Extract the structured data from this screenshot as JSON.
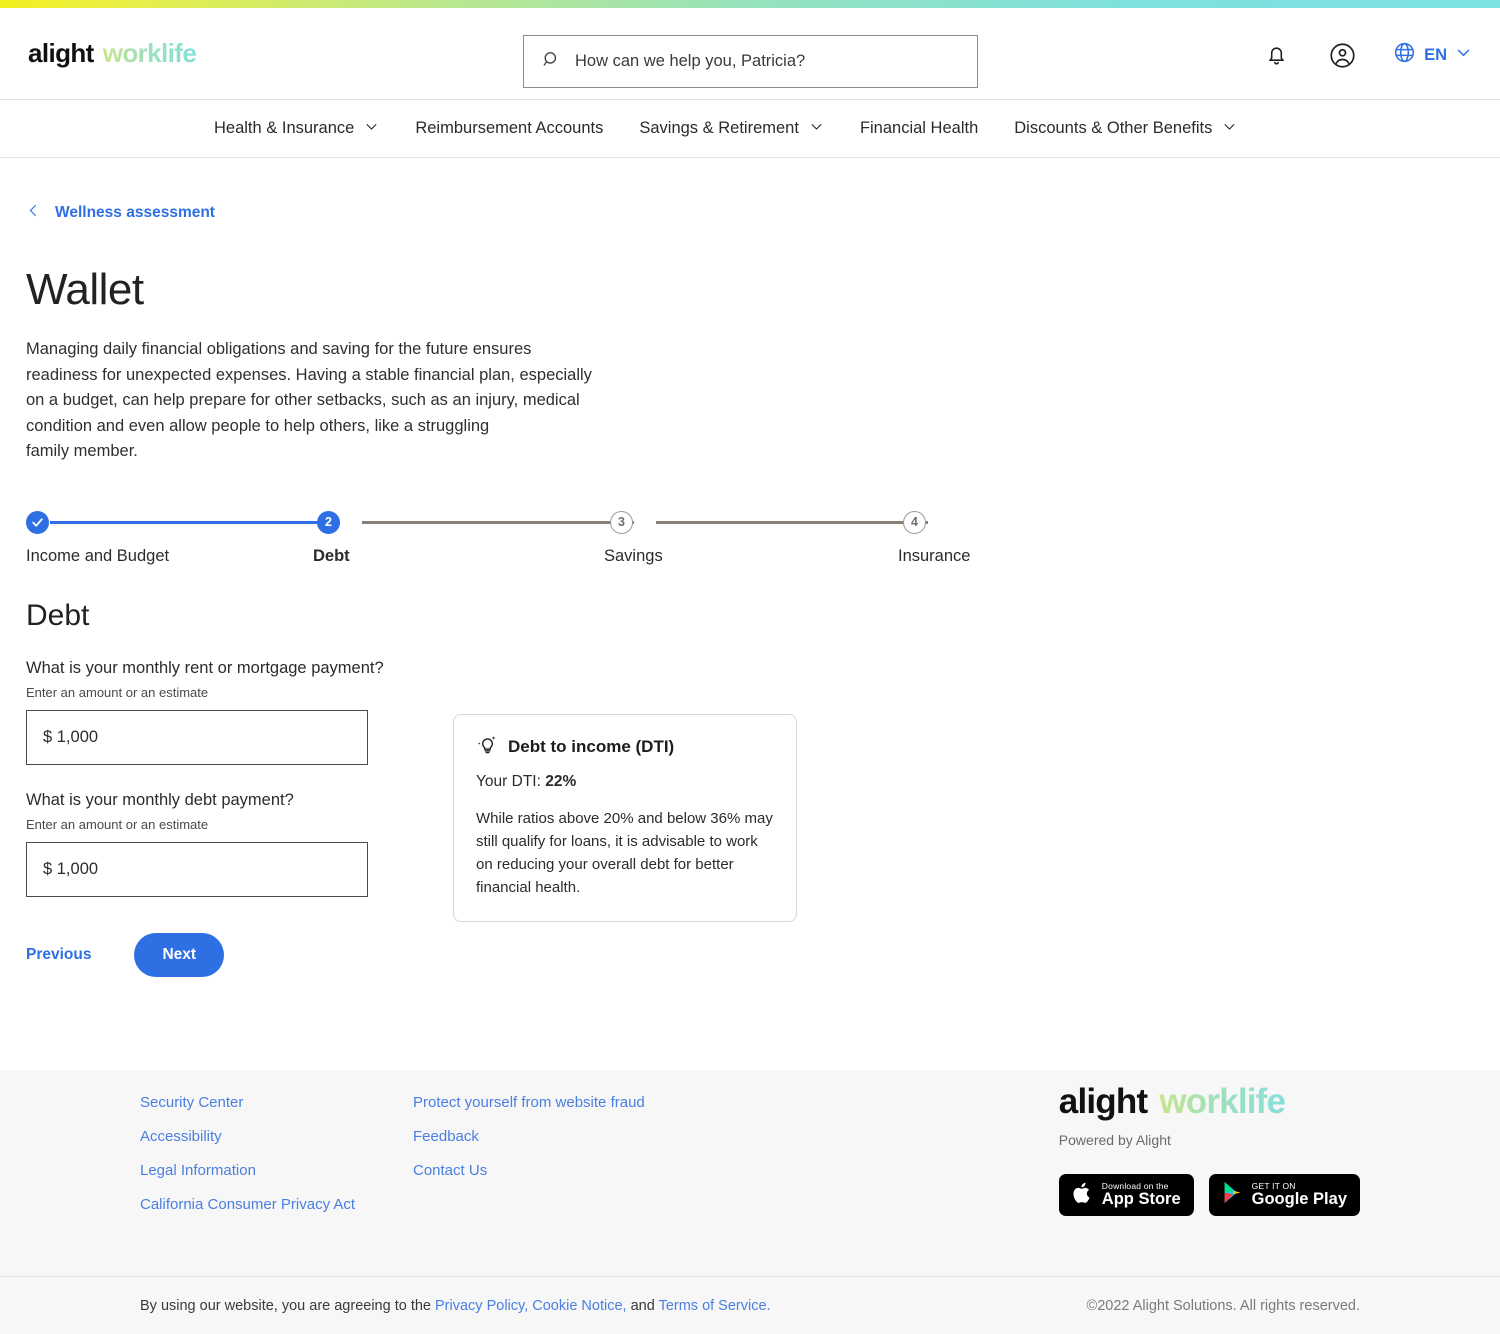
{
  "brand": {
    "logo_primary": "alight",
    "logo_secondary": "worklife",
    "accent_blue": "#2f6fe4",
    "gradient_start": "#f2ef1f",
    "gradient_end": "#7ee1e3"
  },
  "header": {
    "search": {
      "placeholder": "How can we help you, Patricia?",
      "value": "",
      "icon": "search-icon"
    },
    "notifications_icon": "bell-icon",
    "account_icon": "account-circle-icon",
    "language": {
      "icon": "globe-icon",
      "label": "EN",
      "chevron": "chevron-down-icon"
    }
  },
  "nav": {
    "items": [
      {
        "label": "Health & Insurance",
        "has_chevron": true
      },
      {
        "label": "Reimbursement Accounts",
        "has_chevron": false
      },
      {
        "label": "Savings & Retirement",
        "has_chevron": true
      },
      {
        "label": "Financial Health",
        "has_chevron": false
      },
      {
        "label": "Discounts & Other Benefits",
        "has_chevron": true
      }
    ]
  },
  "breadcrumb": {
    "icon": "chevron-left-icon",
    "label": "Wellness assessment"
  },
  "page": {
    "title": "Wallet",
    "description": "Managing daily financial obligations and saving for the future ensures\nreadiness for unexpected expenses. Having a stable financial plan, especially\non a budget, can help prepare for other setbacks, such as an injury, medical\ncondition and even allow people to help others, like a struggling\nfamily member."
  },
  "stepper": {
    "steps": [
      {
        "number": "1",
        "label": "Income and Budget",
        "state": "complete",
        "marker": "check-icon"
      },
      {
        "number": "2",
        "label": "Debt",
        "state": "active",
        "marker": "2"
      },
      {
        "number": "3",
        "label": "Savings",
        "state": "inactive",
        "marker": "3"
      },
      {
        "number": "4",
        "label": "Insurance",
        "state": "inactive",
        "marker": "4"
      }
    ]
  },
  "form": {
    "section_title": "Debt",
    "fields": [
      {
        "label": "What is your monthly rent or mortgage payment?",
        "hint": "Enter an amount or an estimate",
        "value": "$ 1,000",
        "placeholder": "$ 0"
      },
      {
        "label": "What is your monthly debt payment?",
        "hint": "Enter an amount or an estimate",
        "value": "$ 1,000",
        "placeholder": "$ 0"
      }
    ],
    "previous_label": "Previous",
    "next_label": "Next"
  },
  "dti_card": {
    "icon": "lightbulb-idea-icon",
    "title": "Debt to income (DTI)",
    "value_label": "Your DTI:",
    "value": "22%",
    "body": "While ratios above 20% and below 36% may still qualify for loans, it is advisable to work on reducing your overall debt for better financial health."
  },
  "footer": {
    "columns": [
      {
        "links": [
          "Security Center",
          "Accessibility",
          "Legal Information",
          "California Consumer Privacy Act"
        ]
      },
      {
        "links": [
          "Protect yourself from website fraud",
          "Feedback",
          "Contact Us"
        ]
      }
    ],
    "brand": {
      "logo_primary": "alight",
      "logo_secondary": "worklife",
      "powered_by": "Powered by Alight"
    },
    "badges": [
      {
        "icon": "apple-icon",
        "small": "Download on the",
        "big": "App Store"
      },
      {
        "icon": "google-play-icon",
        "small": "GET IT ON",
        "big": "Google Play"
      }
    ],
    "legal": {
      "prefix": "By using our website, you are agreeing to the",
      "link1": "Privacy Policy,",
      "link2": "Cookie Notice,",
      "middle": "and",
      "link3": "Terms of Service.",
      "copyright": "©2022 Alight Solutions. All rights reserved."
    }
  }
}
